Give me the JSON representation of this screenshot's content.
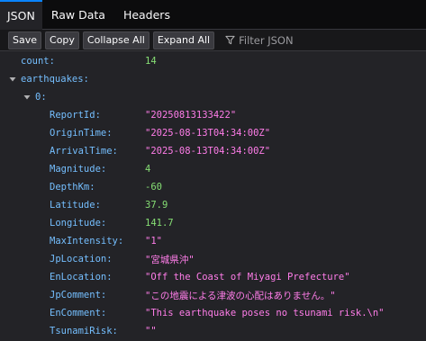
{
  "tabs": [
    {
      "label": "JSON",
      "active": true
    },
    {
      "label": "Raw Data",
      "active": false
    },
    {
      "label": "Headers",
      "active": false
    }
  ],
  "toolbar": {
    "save_label": "Save",
    "copy_label": "Copy",
    "collapse_label": "Collapse All",
    "expand_label": "Expand All",
    "filter_placeholder": "Filter JSON",
    "filter_icon": "funnel-icon"
  },
  "tree": {
    "count": {
      "key": "count:",
      "value": "14"
    },
    "earthquakes": {
      "key": "earthquakes:"
    },
    "item0": {
      "key": "0:"
    },
    "fields": [
      {
        "key": "ReportId:",
        "value": "\"20250813133422\"",
        "kind": "str"
      },
      {
        "key": "OriginTime:",
        "value": "\"2025-08-13T04:34:00Z\"",
        "kind": "str"
      },
      {
        "key": "ArrivalTime:",
        "value": "\"2025-08-13T04:34:00Z\"",
        "kind": "str"
      },
      {
        "key": "Magnitude:",
        "value": "4",
        "kind": "num"
      },
      {
        "key": "DepthKm:",
        "value": "-60",
        "kind": "num"
      },
      {
        "key": "Latitude:",
        "value": "37.9",
        "kind": "num"
      },
      {
        "key": "Longitude:",
        "value": "141.7",
        "kind": "num"
      },
      {
        "key": "MaxIntensity:",
        "value": "\"1\"",
        "kind": "str"
      },
      {
        "key": "JpLocation:",
        "value": "\"宮城県沖\"",
        "kind": "str"
      },
      {
        "key": "EnLocation:",
        "value": "\"Off the Coast of Miyagi Prefecture\"",
        "kind": "str"
      },
      {
        "key": "JpComment:",
        "value": "\"この地震による津波の心配はありません。\"",
        "kind": "str"
      },
      {
        "key": "EnComment:",
        "value": "\"This earthquake poses no tsunami risk.\\n\"",
        "kind": "str"
      },
      {
        "key": "TsunamiRisk:",
        "value": "\"\"",
        "kind": "str"
      }
    ]
  },
  "colors": {
    "key": "#75bfff",
    "string": "#ff7de9",
    "number": "#86de74",
    "accent": "#0a84ff"
  }
}
